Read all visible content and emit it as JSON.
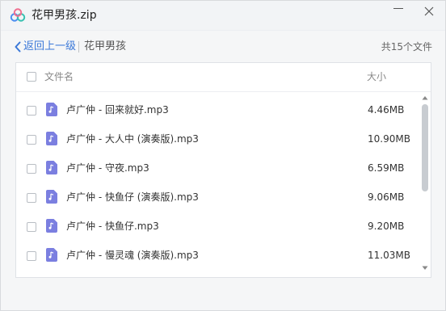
{
  "window": {
    "title": "花甲男孩.zip"
  },
  "nav": {
    "back_label": "返回上一级",
    "current_folder": "花甲男孩",
    "file_count": "共15个文件"
  },
  "list": {
    "header_name": "文件名",
    "header_size": "大小",
    "files": [
      {
        "name": "卢广仲 - 回来就好.mp3",
        "size": "4.46MB",
        "icon": "music-file-icon"
      },
      {
        "name": "卢广仲 - 大人中 (演奏版).mp3",
        "size": "10.90MB",
        "icon": "music-file-icon"
      },
      {
        "name": "卢广仲 - 守夜.mp3",
        "size": "6.59MB",
        "icon": "music-file-icon"
      },
      {
        "name": "卢广仲 - 快鱼仔 (演奏版).mp3",
        "size": "9.06MB",
        "icon": "music-file-icon"
      },
      {
        "name": "卢广仲 - 快鱼仔.mp3",
        "size": "9.20MB",
        "icon": "music-file-icon"
      },
      {
        "name": "卢广仲 - 慢灵魂 (演奏版).mp3",
        "size": "11.03MB",
        "icon": "music-file-icon"
      }
    ]
  },
  "colors": {
    "accent": "#3b78d8",
    "file_icon": "#7b7fe0",
    "logo_blue": "#4a8df0",
    "logo_pink": "#ef6e8f",
    "logo_teal": "#37c0b0"
  }
}
